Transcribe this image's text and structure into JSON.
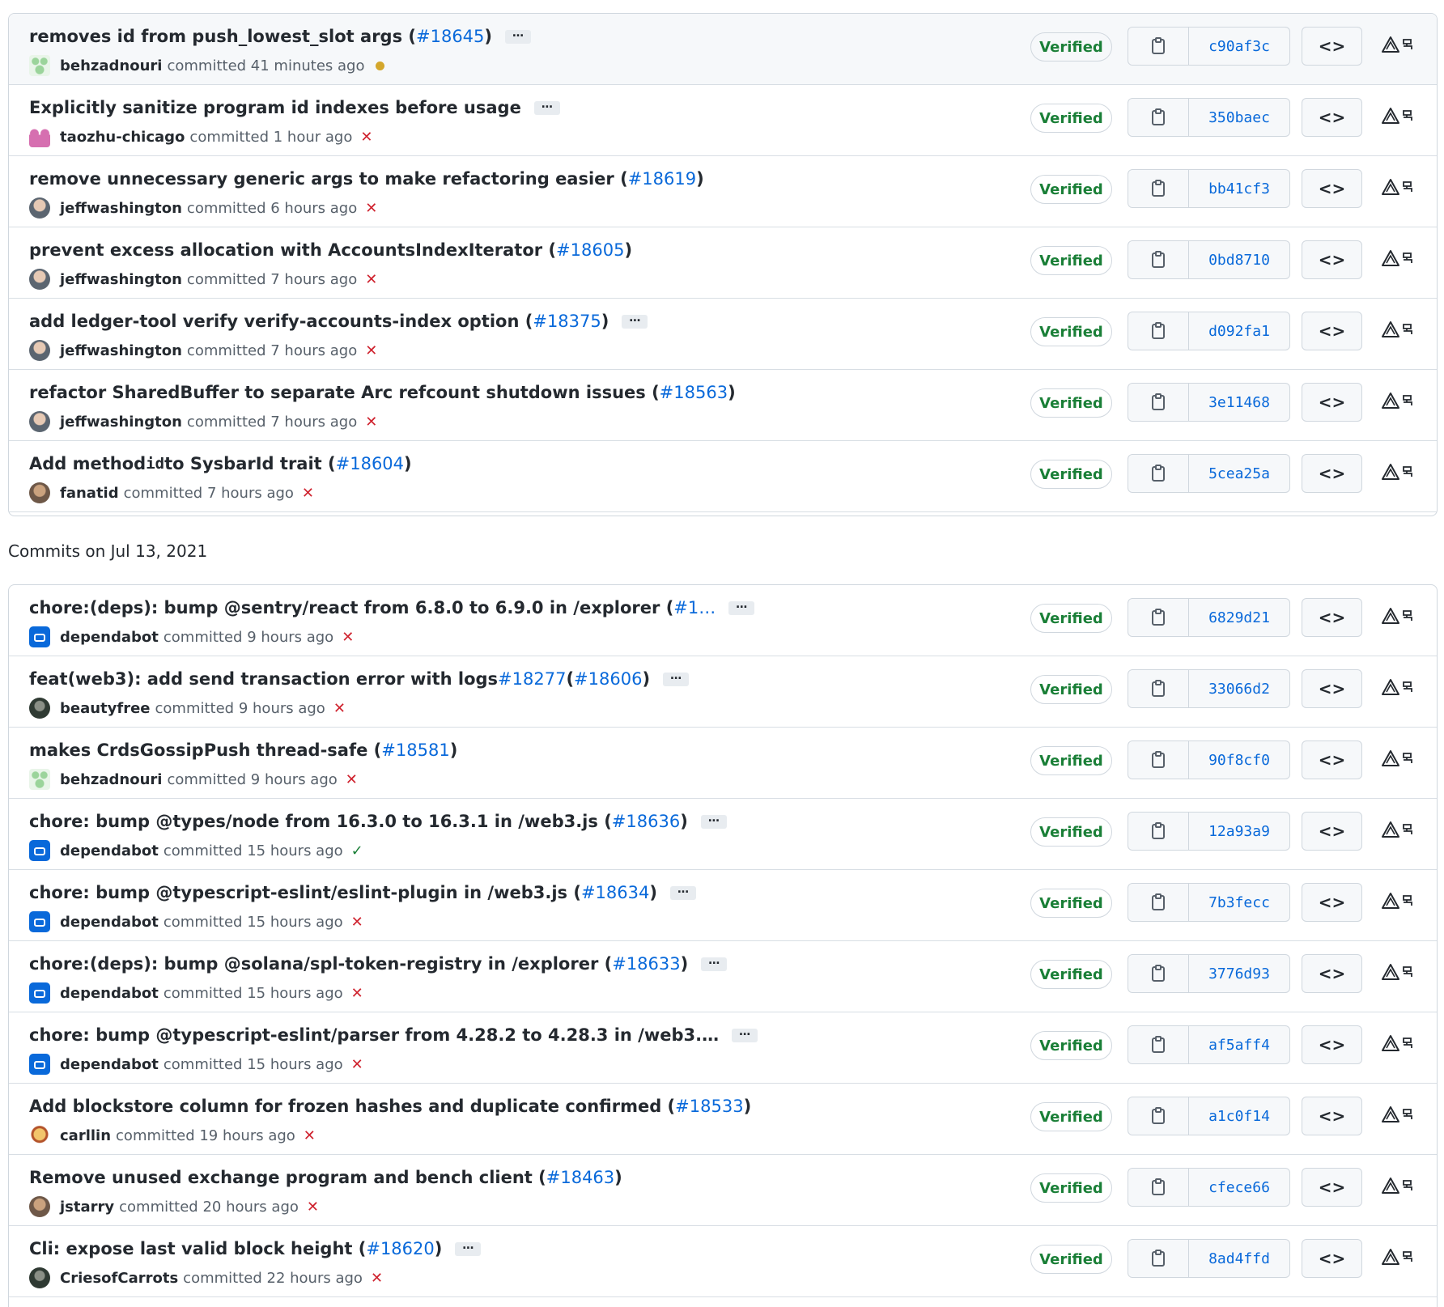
{
  "colors": {
    "link": "#0969da",
    "verified": "#1a7f37",
    "failed": "#cf222e",
    "pending": "#d4a72c"
  },
  "labels": {
    "verified": "Verified",
    "committed": "committed",
    "browse": "<>",
    "ext_icon": "⚠︎⩩",
    "more": "…"
  },
  "date_heading": "Commits on Jul 13, 2021",
  "groups": [
    {
      "commits": [
        {
          "pre": "removes id from push_lowest_slot args (",
          "link": "#18645",
          "post": ")",
          "more": true,
          "author": "behzadnouri",
          "avatar": "av-identicon-green",
          "time": "41 minutes ago",
          "status": "pending",
          "sha": "c90af3c"
        },
        {
          "pre": "Explicitly sanitize program id indexes before usage",
          "link": "",
          "post": "",
          "more": true,
          "author": "taozhu-chicago",
          "avatar": "av-identicon-pink",
          "time": "1 hour ago",
          "status": "failed",
          "sha": "350baec"
        },
        {
          "pre": "remove unnecessary generic args to make refactoring easier (",
          "link": "#18619",
          "post": ")",
          "more": false,
          "author": "jeffwashington",
          "avatar": "av-photo-gray",
          "time": "6 hours ago",
          "status": "failed",
          "sha": "bb41cf3"
        },
        {
          "pre": "prevent excess allocation with AccountsIndexIterator (",
          "link": "#18605",
          "post": ")",
          "more": false,
          "author": "jeffwashington",
          "avatar": "av-photo-gray",
          "time": "7 hours ago",
          "status": "failed",
          "sha": "0bd8710"
        },
        {
          "pre": "add ledger-tool verify verify-accounts-index option (",
          "link": "#18375",
          "post": ")",
          "more": true,
          "author": "jeffwashington",
          "avatar": "av-photo-gray",
          "time": "7 hours ago",
          "status": "failed",
          "sha": "d092fa1"
        },
        {
          "pre": "refactor SharedBuffer to separate Arc refcount shutdown issues (",
          "link": "#18563",
          "post": ")",
          "more": false,
          "author": "jeffwashington",
          "avatar": "av-photo-gray",
          "time": "7 hours ago",
          "status": "failed",
          "sha": "3e11468"
        },
        {
          "pre": "Add method ",
          "code": "id",
          "pre2": " to SysbarId trait (",
          "link": "#18604",
          "post": ")",
          "more": false,
          "author": "fanatid",
          "avatar": "av-photo-brown",
          "time": "7 hours ago",
          "status": "failed",
          "sha": "5cea25a"
        }
      ]
    },
    {
      "commits": [
        {
          "pre": "chore:(deps): bump @sentry/react from 6.8.0 to 6.9.0 in /explorer (",
          "link": "#1…",
          "post": "",
          "more": true,
          "author": "dependabot",
          "avatar": "av-bot",
          "time": "9 hours ago",
          "status": "failed",
          "sha": "6829d21"
        },
        {
          "pre": "feat(web3): add send transaction error with logs ",
          "link": "#18277",
          "mid": " (",
          "link2": "#18606",
          "post": ")",
          "more": true,
          "author": "beautyfree",
          "avatar": "av-photo-dark",
          "time": "9 hours ago",
          "status": "failed",
          "sha": "33066d2"
        },
        {
          "pre": "makes CrdsGossipPush thread-safe (",
          "link": "#18581",
          "post": ")",
          "more": false,
          "author": "behzadnouri",
          "avatar": "av-identicon-green",
          "time": "9 hours ago",
          "status": "failed",
          "sha": "90f8cf0"
        },
        {
          "pre": "chore: bump @types/node from 16.3.0 to 16.3.1 in /web3.js (",
          "link": "#18636",
          "post": ")",
          "more": true,
          "author": "dependabot",
          "avatar": "av-bot",
          "time": "15 hours ago",
          "status": "success",
          "sha": "12a93a9"
        },
        {
          "pre": "chore: bump @typescript-eslint/eslint-plugin in /web3.js (",
          "link": "#18634",
          "post": ")",
          "more": true,
          "author": "dependabot",
          "avatar": "av-bot",
          "time": "15 hours ago",
          "status": "failed",
          "sha": "7b3fecc"
        },
        {
          "pre": "chore:(deps): bump @solana/spl-token-registry in /explorer (",
          "link": "#18633",
          "post": ")",
          "more": true,
          "author": "dependabot",
          "avatar": "av-bot",
          "time": "15 hours ago",
          "status": "failed",
          "sha": "3776d93"
        },
        {
          "pre": "chore: bump @typescript-eslint/parser from 4.28.2 to 4.28.3 in /web3.…",
          "link": "",
          "post": "",
          "more": true,
          "author": "dependabot",
          "avatar": "av-bot",
          "time": "15 hours ago",
          "status": "failed",
          "sha": "af5aff4"
        },
        {
          "pre": "Add blockstore column for frozen hashes and duplicate confirmed (",
          "link": "#18533",
          "post": ")",
          "more": false,
          "author": "carllin",
          "avatar": "av-cartoon",
          "time": "19 hours ago",
          "status": "failed",
          "sha": "a1c0f14"
        },
        {
          "pre": "Remove unused exchange program and bench client (",
          "link": "#18463",
          "post": ")",
          "more": false,
          "author": "jstarry",
          "avatar": "av-photo-brown",
          "time": "20 hours ago",
          "status": "failed",
          "sha": "cfece66"
        },
        {
          "pre": "Cli: expose last valid block height (",
          "link": "#18620",
          "post": ")",
          "more": true,
          "author": "CriesofCarrots",
          "avatar": "av-photo-dark",
          "time": "22 hours ago",
          "status": "failed",
          "sha": "8ad4ffd"
        }
      ]
    }
  ]
}
